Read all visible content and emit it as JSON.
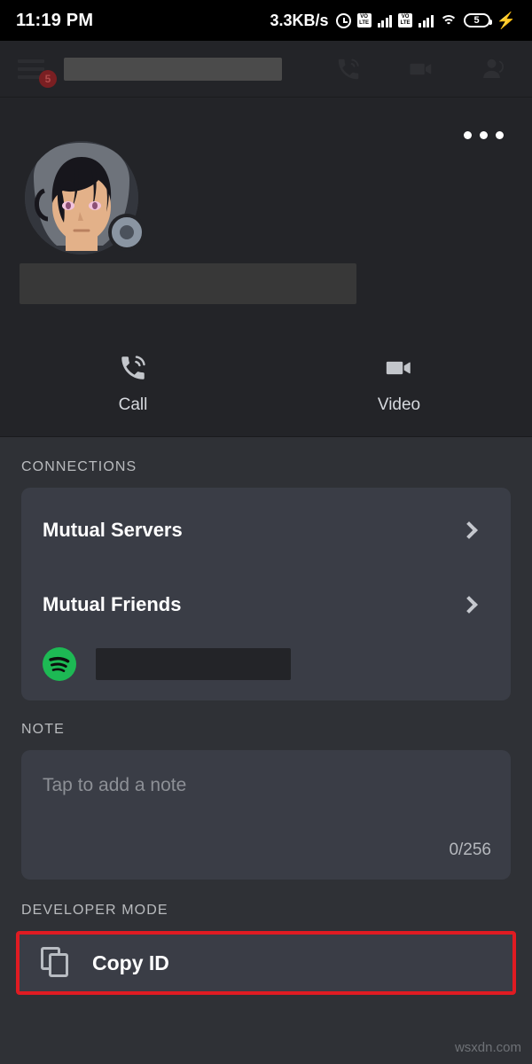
{
  "status_bar": {
    "time": "11:19 PM",
    "network_speed": "3.3KB/s",
    "alarm_icon": "alarm-icon",
    "volte_label_top": "VO",
    "volte_label_bottom": "LTE",
    "wifi_icon": "wifi-icon",
    "battery_level": "5",
    "charging_icon": "⚡"
  },
  "top_nav": {
    "menu_icon": "hamburger-menu-icon",
    "unread_badge": "5",
    "title_redacted": "",
    "call_icon": "voice-call-icon",
    "video_icon": "video-call-icon",
    "members_icon": "members-icon"
  },
  "profile": {
    "overflow_menu_icon": "more-options-icon",
    "avatar_icon": "user-avatar",
    "presence_status": "offline",
    "username_redacted": ""
  },
  "actions": [
    {
      "label": "Call",
      "icon": "voice-call-icon"
    },
    {
      "label": "Video",
      "icon": "video-call-icon"
    }
  ],
  "connections": {
    "heading": "CONNECTIONS",
    "rows": [
      {
        "label": "Mutual Servers",
        "chevron": "chevron-right-icon"
      },
      {
        "label": "Mutual Friends",
        "chevron": "chevron-right-icon"
      }
    ],
    "spotify": {
      "icon": "spotify-icon",
      "color": "#1DB954",
      "value_redacted": ""
    }
  },
  "note": {
    "heading": "NOTE",
    "placeholder": "Tap to add a note",
    "value": "",
    "counter": "0/256"
  },
  "developer_mode": {
    "heading": "DEVELOPER MODE",
    "copy_id_label": "Copy ID",
    "copy_icon": "copy-icon",
    "highlight_color": "#e01b22"
  },
  "watermark": "wsxdn.com"
}
